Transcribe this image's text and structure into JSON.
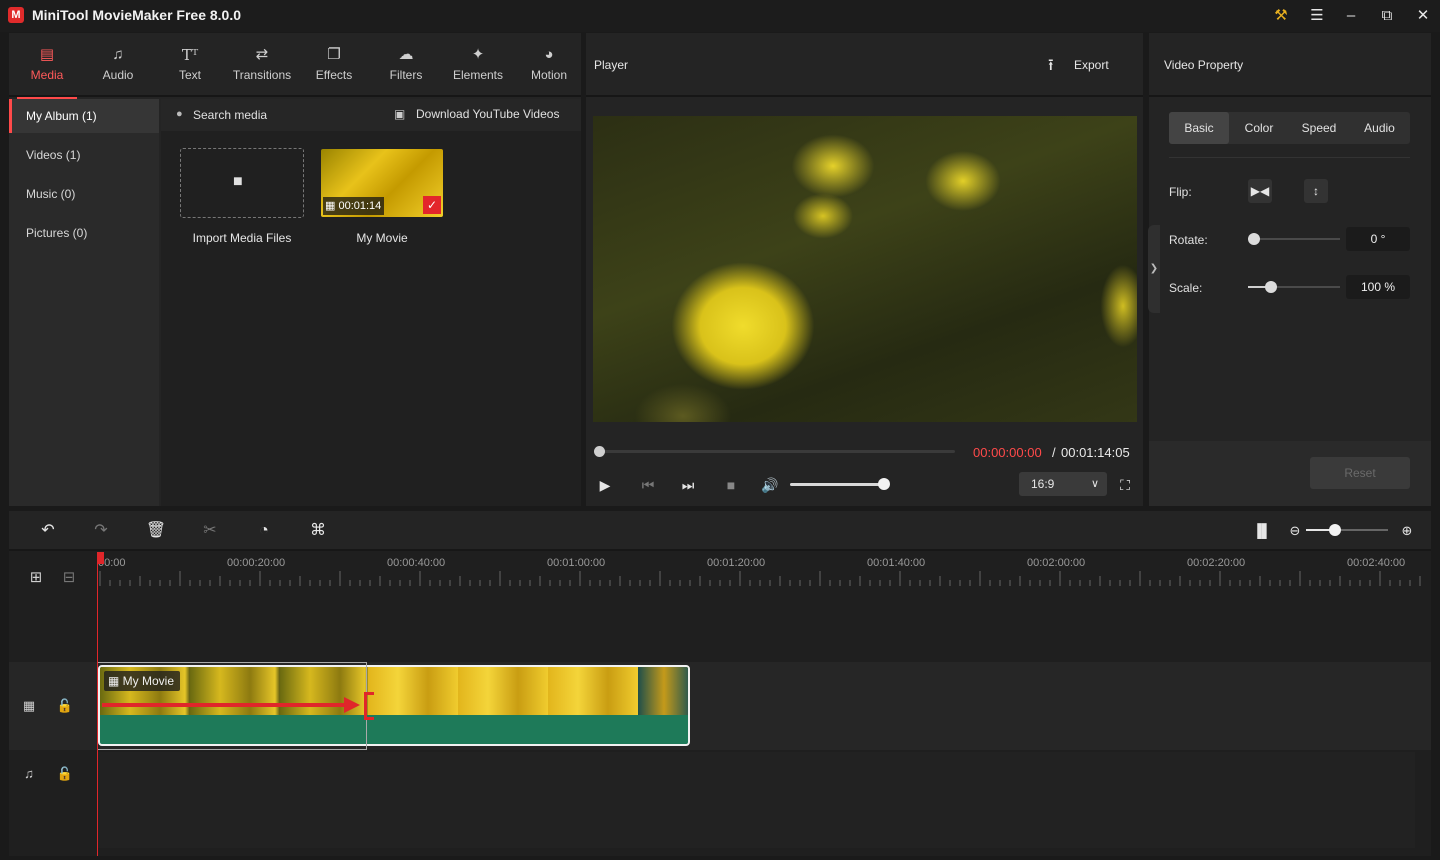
{
  "app": {
    "title": "MiniTool MovieMaker Free 8.0.0",
    "logo_letter": "M",
    "icons": [
      "key-icon",
      "menu-icon",
      "minimize-icon",
      "maximize-icon",
      "close-icon"
    ]
  },
  "media_tabs": [
    {
      "label": "Media",
      "icon": "media-icon",
      "active": true
    },
    {
      "label": "Audio",
      "icon": "music-note-icon"
    },
    {
      "label": "Text",
      "icon": "text-icon"
    },
    {
      "label": "Transitions",
      "icon": "transitions-icon"
    },
    {
      "label": "Effects",
      "icon": "effects-icon"
    },
    {
      "label": "Filters",
      "icon": "filters-icon"
    },
    {
      "label": "Elements",
      "icon": "elements-icon"
    },
    {
      "label": "Motion",
      "icon": "motion-icon"
    }
  ],
  "album": {
    "items": [
      {
        "label": "My Album (1)",
        "active": true
      },
      {
        "label": "Videos (1)"
      },
      {
        "label": "Music (0)"
      },
      {
        "label": "Pictures (0)"
      }
    ]
  },
  "media": {
    "search_label": "Search media",
    "download_label": "Download YouTube Videos",
    "import_label": "Import Media Files",
    "clip_name": "My Movie",
    "clip_duration": "00:01:14"
  },
  "player": {
    "title": "Player",
    "export_label": "Export",
    "time_current": "00:00:00:00",
    "time_separator": "/",
    "time_total": "00:01:14:05",
    "aspect_ratio": "16:9",
    "progress": 0.0,
    "volume": 0.93
  },
  "property": {
    "title": "Video Property",
    "tabs": [
      "Basic",
      "Color",
      "Speed",
      "Audio"
    ],
    "active_tab": "Basic",
    "flip_label": "Flip:",
    "rotate_label": "Rotate:",
    "rotate_value": "0 °",
    "rotate_level": 0.0,
    "scale_label": "Scale:",
    "scale_value": "100 %",
    "scale_level": 0.25,
    "reset_label": "Reset"
  },
  "timeline": {
    "ruler_labels": [
      "00:00",
      "00:00:20:00",
      "00:00:40:00",
      "00:01:00:00",
      "00:01:20:00",
      "00:01:40:00",
      "00:02:00:00",
      "00:02:20:00",
      "00:02:40:00"
    ],
    "clip_label": "My Movie",
    "zoom_level": 0.33
  },
  "colors": {
    "accent": "#ff4a4a",
    "clip_green": "#1e7a59",
    "panel": "#242424"
  }
}
